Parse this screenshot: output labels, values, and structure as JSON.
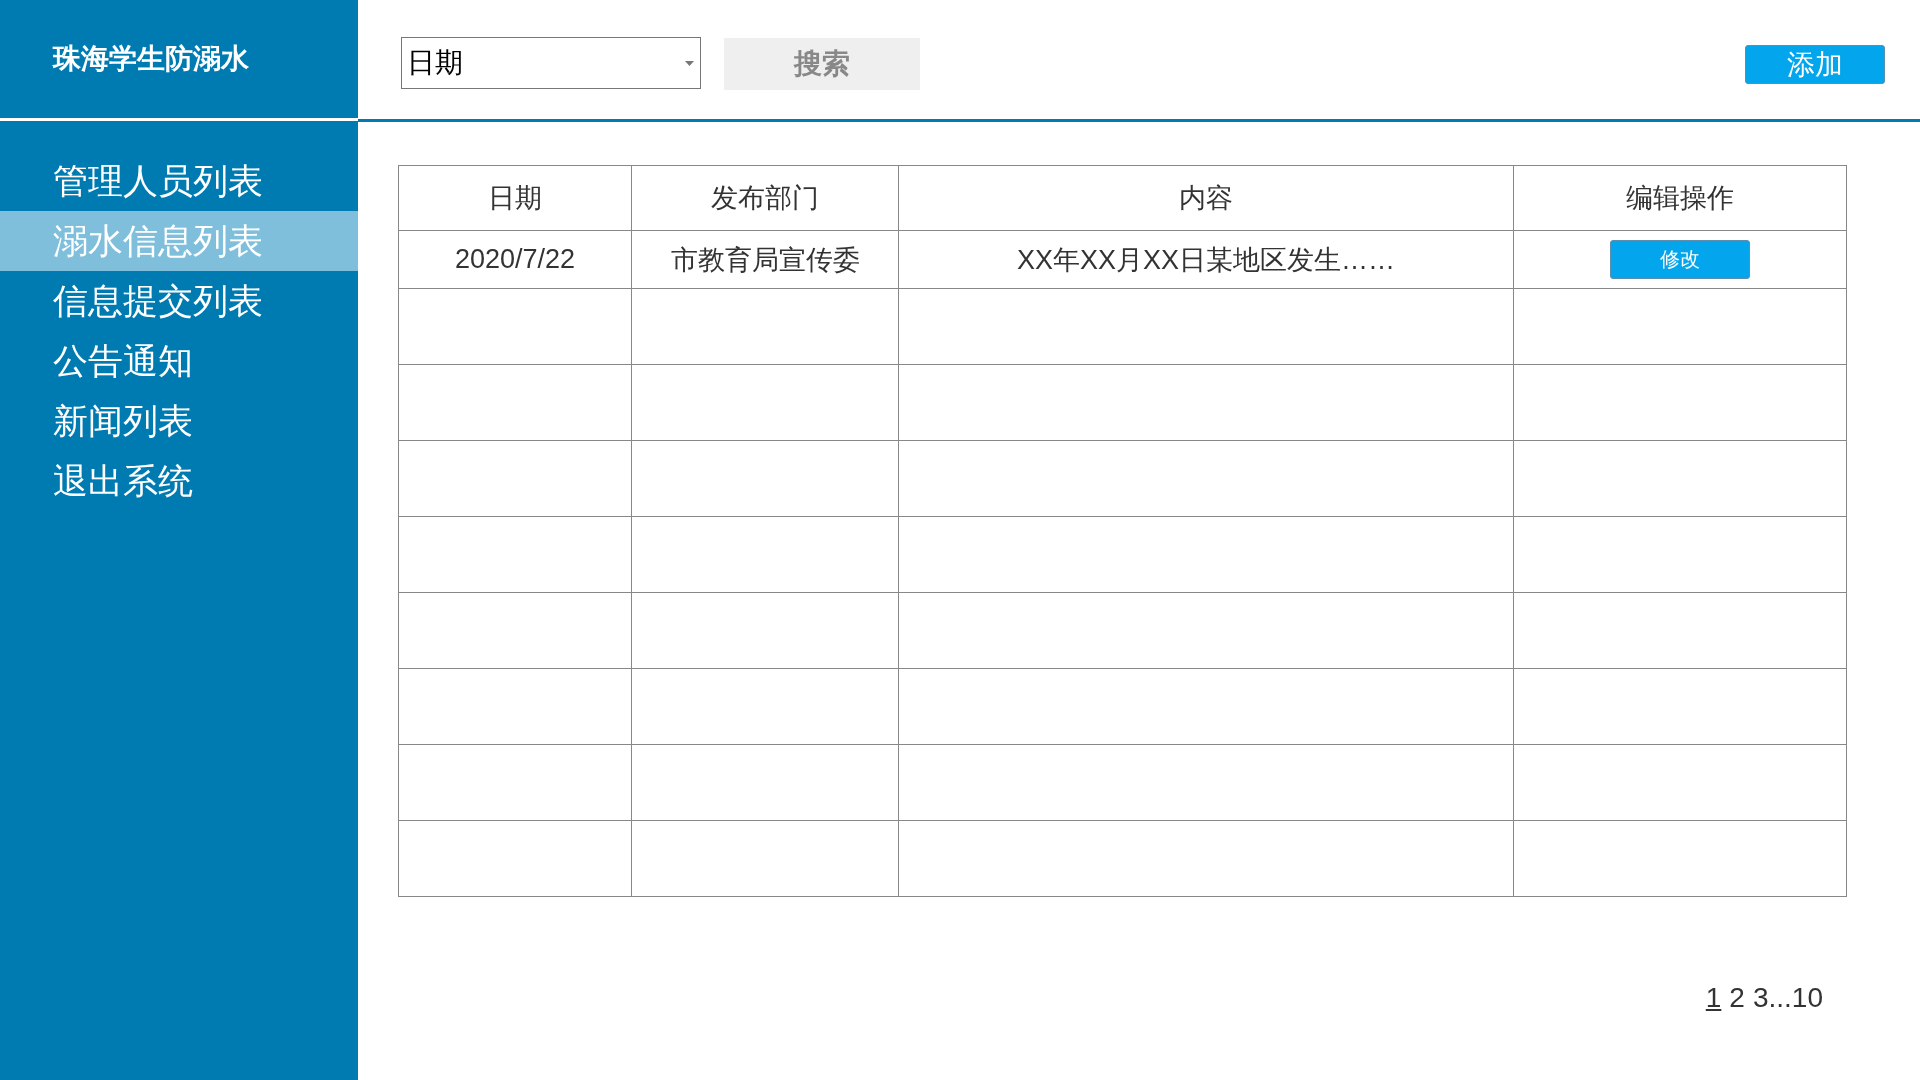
{
  "sidebar": {
    "title": "珠海学生防溺水",
    "items": [
      {
        "label": "管理人员列表",
        "selected": false
      },
      {
        "label": "溺水信息列表",
        "selected": true
      },
      {
        "label": "信息提交列表",
        "selected": false
      },
      {
        "label": "公告通知",
        "selected": false
      },
      {
        "label": "新闻列表",
        "selected": false
      },
      {
        "label": "退出系统",
        "selected": false
      }
    ]
  },
  "toolbar": {
    "filter_dropdown": {
      "value": "日期"
    },
    "search_button": "搜索",
    "add_button": "添加"
  },
  "table": {
    "columns": [
      "日期",
      "发布部门",
      "内容",
      "编辑操作"
    ],
    "rows": [
      {
        "date": "2020/7/22",
        "department": "市教育局宣传委",
        "content": "XX年XX月XX日某地区发生……",
        "action_button": "修改"
      }
    ]
  },
  "pagination": [
    {
      "kind": "page",
      "label": "1",
      "selected": true
    },
    {
      "kind": "page",
      "label": "2",
      "selected": false
    },
    {
      "kind": "page",
      "label": "3",
      "selected": false
    },
    {
      "kind": "ellipsis",
      "label": "..."
    },
    {
      "kind": "page",
      "label": "10",
      "selected": false
    }
  ]
}
